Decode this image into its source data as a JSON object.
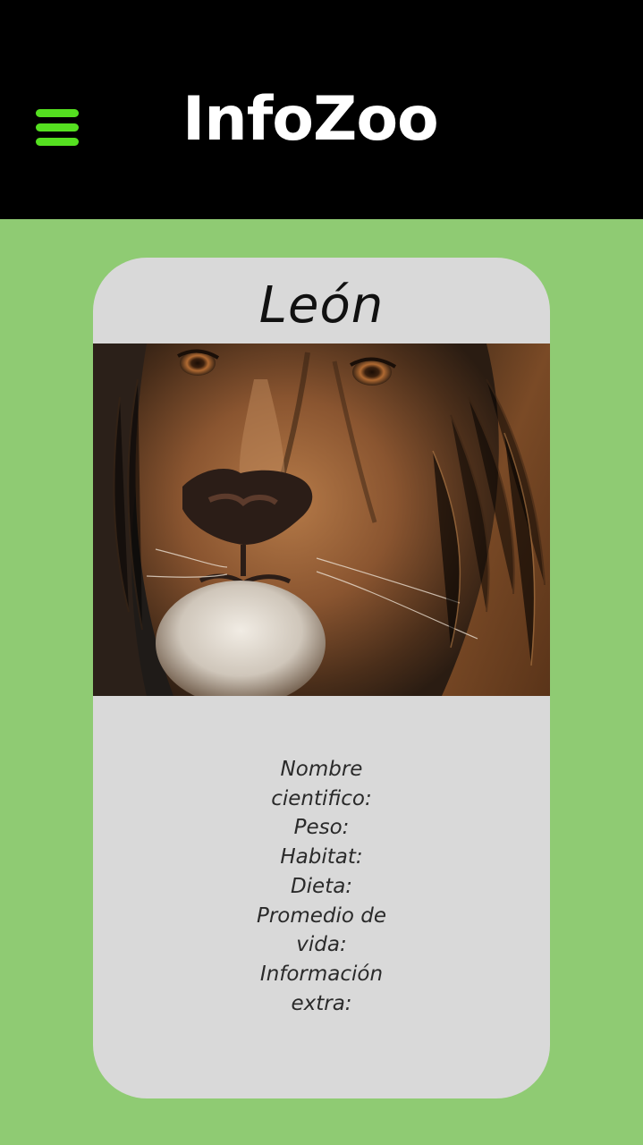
{
  "header": {
    "title": "InfoZoo",
    "menu_icon": "hamburger-menu-icon",
    "menu_color": "#55e020",
    "background": "#000000"
  },
  "page": {
    "background": "#8fcb73"
  },
  "card": {
    "title": "León",
    "photo": "lion-face-photo",
    "fields": [
      "Nombre cientifico:",
      "Peso:",
      "Habitat:",
      "Dieta:",
      "Promedio de vida:",
      "Información extra:"
    ]
  }
}
